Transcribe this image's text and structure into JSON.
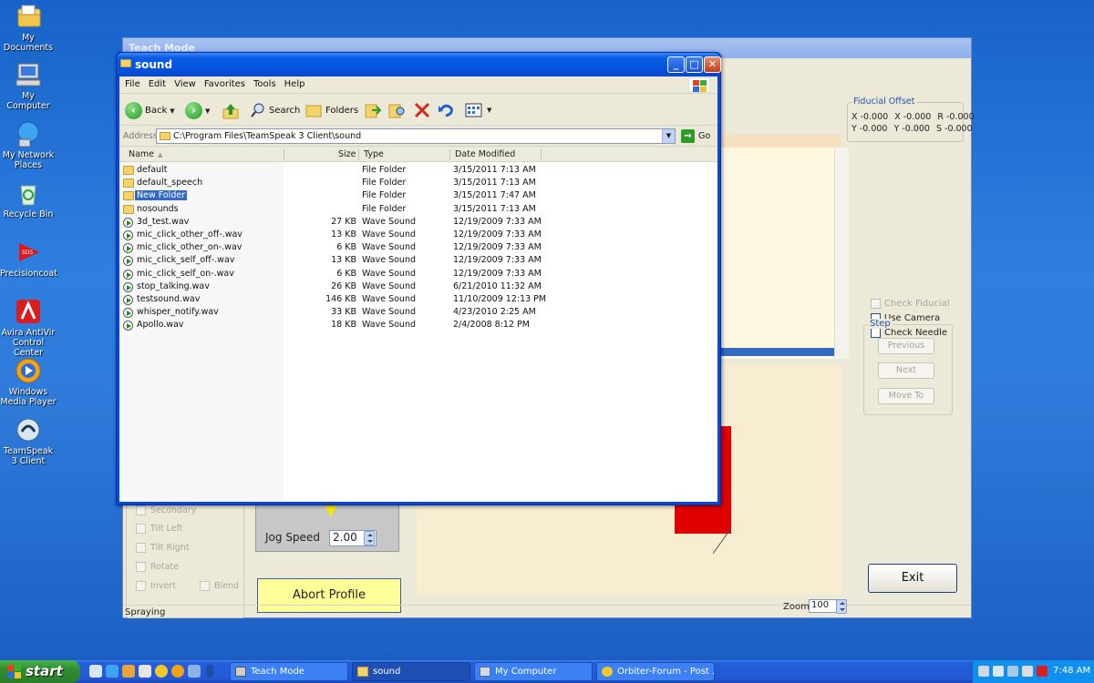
{
  "desktop": {
    "icons": [
      {
        "label": "My Documents",
        "icon": "my-documents-icon"
      },
      {
        "label": "My Computer",
        "icon": "my-computer-icon"
      },
      {
        "label": "My Network Places",
        "icon": "network-places-icon"
      },
      {
        "label": "Recycle Bin",
        "icon": "recycle-bin-icon"
      },
      {
        "label": "Precisioncoat",
        "icon": "precisioncoat-icon"
      },
      {
        "label": "Avira AntiVir Control Center",
        "icon": "avira-icon"
      },
      {
        "label": "Windows Media Player",
        "icon": "media-player-icon"
      },
      {
        "label": "TeamSpeak 3 Client",
        "icon": "teamspeak-icon"
      }
    ]
  },
  "teach": {
    "title": "Teach Mode",
    "fiducial": {
      "title": "Fiducial Offset",
      "row1": [
        "X -0.000",
        "X -0.000",
        "R -0.000"
      ],
      "row2": [
        "Y -0.000",
        "Y -0.000",
        "S -0.000"
      ]
    },
    "checks": {
      "fiducial": "Check Fiducial",
      "camera": "Use Camera",
      "needle": "Check Needle"
    },
    "step": {
      "title": "Step",
      "previous": "Previous",
      "next": "Next",
      "move_to": "Move To"
    },
    "left_options": [
      "Secondary",
      "Tilt Left",
      "Tilt Right",
      "Rotate",
      "Invert"
    ],
    "blend": "Blend",
    "jog_label": "Jog Speed",
    "jog_value": "2.00",
    "abort": "Abort Profile",
    "exit": "Exit",
    "status": "Spraying",
    "zoom_label": "Zoom",
    "zoom_value": "100"
  },
  "explorer": {
    "title": "sound",
    "menu": [
      "File",
      "Edit",
      "View",
      "Favorites",
      "Tools",
      "Help"
    ],
    "toolbar": {
      "back": "Back",
      "search": "Search",
      "folders": "Folders"
    },
    "address_label": "Address",
    "address": "C:\\Program Files\\TeamSpeak 3 Client\\sound",
    "go": "Go",
    "columns": {
      "name": "Name",
      "size": "Size",
      "type": "Type",
      "date": "Date Modified"
    },
    "files": [
      {
        "name": "default",
        "size": "",
        "type": "File Folder",
        "date": "3/15/2011 7:13 AM",
        "kind": "folder"
      },
      {
        "name": "default_speech",
        "size": "",
        "type": "File Folder",
        "date": "3/15/2011 7:13 AM",
        "kind": "folder"
      },
      {
        "name": "New Folder",
        "size": "",
        "type": "File Folder",
        "date": "3/15/2011 7:47 AM",
        "kind": "folder"
      },
      {
        "name": "nosounds",
        "size": "",
        "type": "File Folder",
        "date": "3/15/2011 7:13 AM",
        "kind": "folder"
      },
      {
        "name": "3d_test.wav",
        "size": "27 KB",
        "type": "Wave Sound",
        "date": "12/19/2009 7:33 AM",
        "kind": "wav"
      },
      {
        "name": "mic_click_other_off-.wav",
        "size": "13 KB",
        "type": "Wave Sound",
        "date": "12/19/2009 7:33 AM",
        "kind": "wav"
      },
      {
        "name": "mic_click_other_on-.wav",
        "size": "6 KB",
        "type": "Wave Sound",
        "date": "12/19/2009 7:33 AM",
        "kind": "wav"
      },
      {
        "name": "mic_click_self_off-.wav",
        "size": "13 KB",
        "type": "Wave Sound",
        "date": "12/19/2009 7:33 AM",
        "kind": "wav"
      },
      {
        "name": "mic_click_self_on-.wav",
        "size": "6 KB",
        "type": "Wave Sound",
        "date": "12/19/2009 7:33 AM",
        "kind": "wav"
      },
      {
        "name": "stop_talking.wav",
        "size": "26 KB",
        "type": "Wave Sound",
        "date": "6/21/2010 11:32 AM",
        "kind": "wav"
      },
      {
        "name": "testsound.wav",
        "size": "146 KB",
        "type": "Wave Sound",
        "date": "11/10/2009 12:13 PM",
        "kind": "wav"
      },
      {
        "name": "whisper_notify.wav",
        "size": "33 KB",
        "type": "Wave Sound",
        "date": "4/23/2010 2:25 AM",
        "kind": "wav"
      },
      {
        "name": "Apollo.wav",
        "size": "18 KB",
        "type": "Wave Sound",
        "date": "2/4/2008 8:12 PM",
        "kind": "wav"
      }
    ],
    "selected": "New Folder"
  },
  "taskbar": {
    "start": "start",
    "tasks": [
      {
        "label": "Teach Mode",
        "active": false
      },
      {
        "label": "sound",
        "active": true
      },
      {
        "label": "My Computer",
        "active": false
      },
      {
        "label": "Orbiter-Forum - Post ...",
        "active": false
      }
    ],
    "clock": "7:48 AM"
  }
}
